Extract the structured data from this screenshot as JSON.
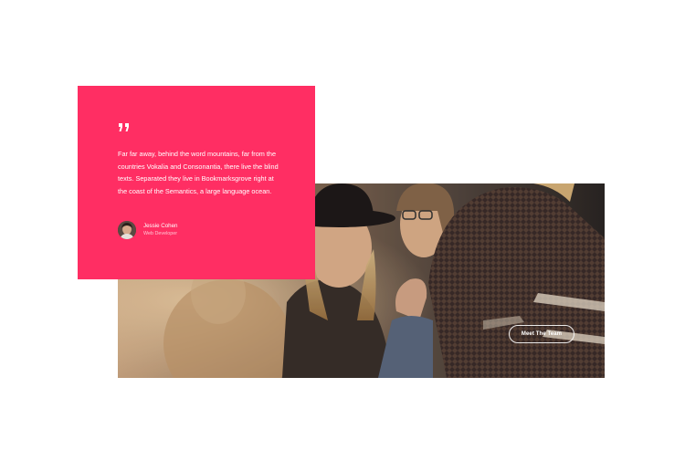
{
  "testimonial": {
    "quote": "Far far away, behind the word mountains, far from the countries Vokalia and Consonantia, there live the blind texts. Separated they live in Bookmarksgrove right at the coast of the Semantics, a large language ocean.",
    "author_name": "Jessie Cohen",
    "author_role": "Web Developer",
    "quote_icon": "quote-icon",
    "accent_color": "#ff2e63"
  },
  "team": {
    "button_label": "Meet The Team"
  }
}
